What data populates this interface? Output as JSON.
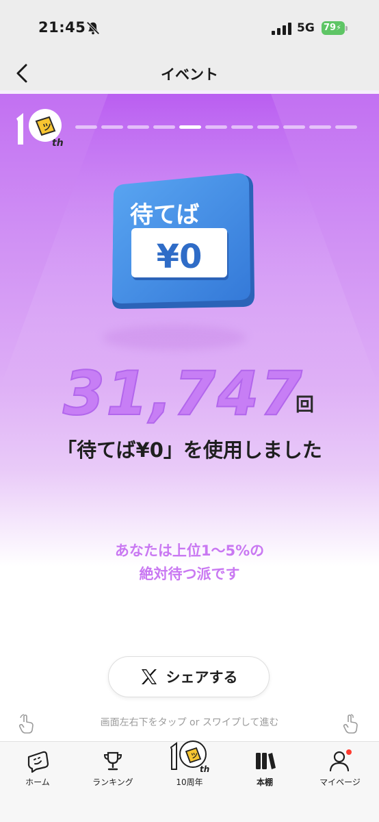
{
  "status_bar": {
    "time": "21:45",
    "network": "5G",
    "battery": "79"
  },
  "header": {
    "title": "イベント"
  },
  "story": {
    "progress_total": 11,
    "progress_active_index": 4,
    "ticket_top": "待てば",
    "ticket_price": "¥0",
    "count": "31,747",
    "count_unit": "回",
    "used_text": "「待てば¥0」を使用しました",
    "rank_line1": "あなたは上位1〜5%の",
    "rank_line2": "絶対待つ派です",
    "share_label": "シェアする",
    "hint": "画面左右下をタップ or スワイプして進む",
    "tenth_badge": "th"
  },
  "tabs": [
    {
      "label": "ホーム",
      "icon": "home-mascot-icon",
      "active": false
    },
    {
      "label": "ランキング",
      "icon": "trophy-icon",
      "active": false
    },
    {
      "label": "10周年",
      "icon": "tenth-anniversary-icon",
      "active": false
    },
    {
      "label": "本棚",
      "icon": "bookshelf-icon",
      "active": true
    },
    {
      "label": "マイページ",
      "icon": "user-icon",
      "active": false,
      "notification": true
    }
  ],
  "colors": {
    "accent_purple": "#c77ef5",
    "ticket_blue": "#3c8ee6",
    "badge_yellow": "#f7c531",
    "notification_red": "#ff3b30"
  }
}
